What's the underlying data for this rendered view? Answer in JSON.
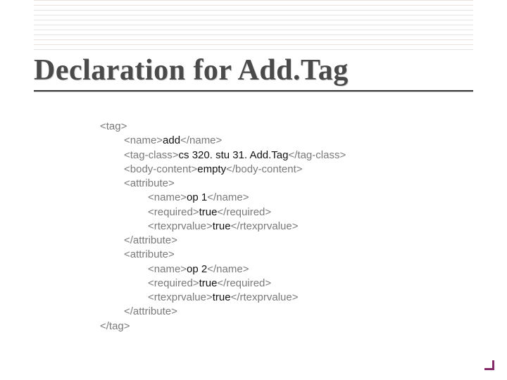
{
  "title": "Declaration for Add.Tag",
  "code": {
    "l01": "<tag>",
    "l02_open": "<name>",
    "l02_val": "add",
    "l02_close": "</name>",
    "l03_open": "<tag-class>",
    "l03_val": "cs 320. stu 31. Add.Tag",
    "l03_close": "</tag-class>",
    "l04_open": "<body-content>",
    "l04_val": "empty",
    "l04_close": "</body-content>",
    "l05": "<attribute>",
    "l06_open": "<name>",
    "l06_val": "op 1",
    "l06_close": "</name>",
    "l07_open": "<required>",
    "l07_val": "true",
    "l07_close": "</required>",
    "l08_open": "<rtexprvalue>",
    "l08_val": "true",
    "l08_close": "</rtexprvalue>",
    "l09": "</attribute>",
    "l10": "<attribute>",
    "l11_open": "<name>",
    "l11_val": "op 2",
    "l11_close": "</name>",
    "l12_open": "<required>",
    "l12_val": "true",
    "l12_close": "</required>",
    "l13_open": "<rtexprvalue>",
    "l13_val": "true",
    "l13_close": "</rtexprvalue>",
    "l14": "</attribute>",
    "l15": "</tag>"
  }
}
